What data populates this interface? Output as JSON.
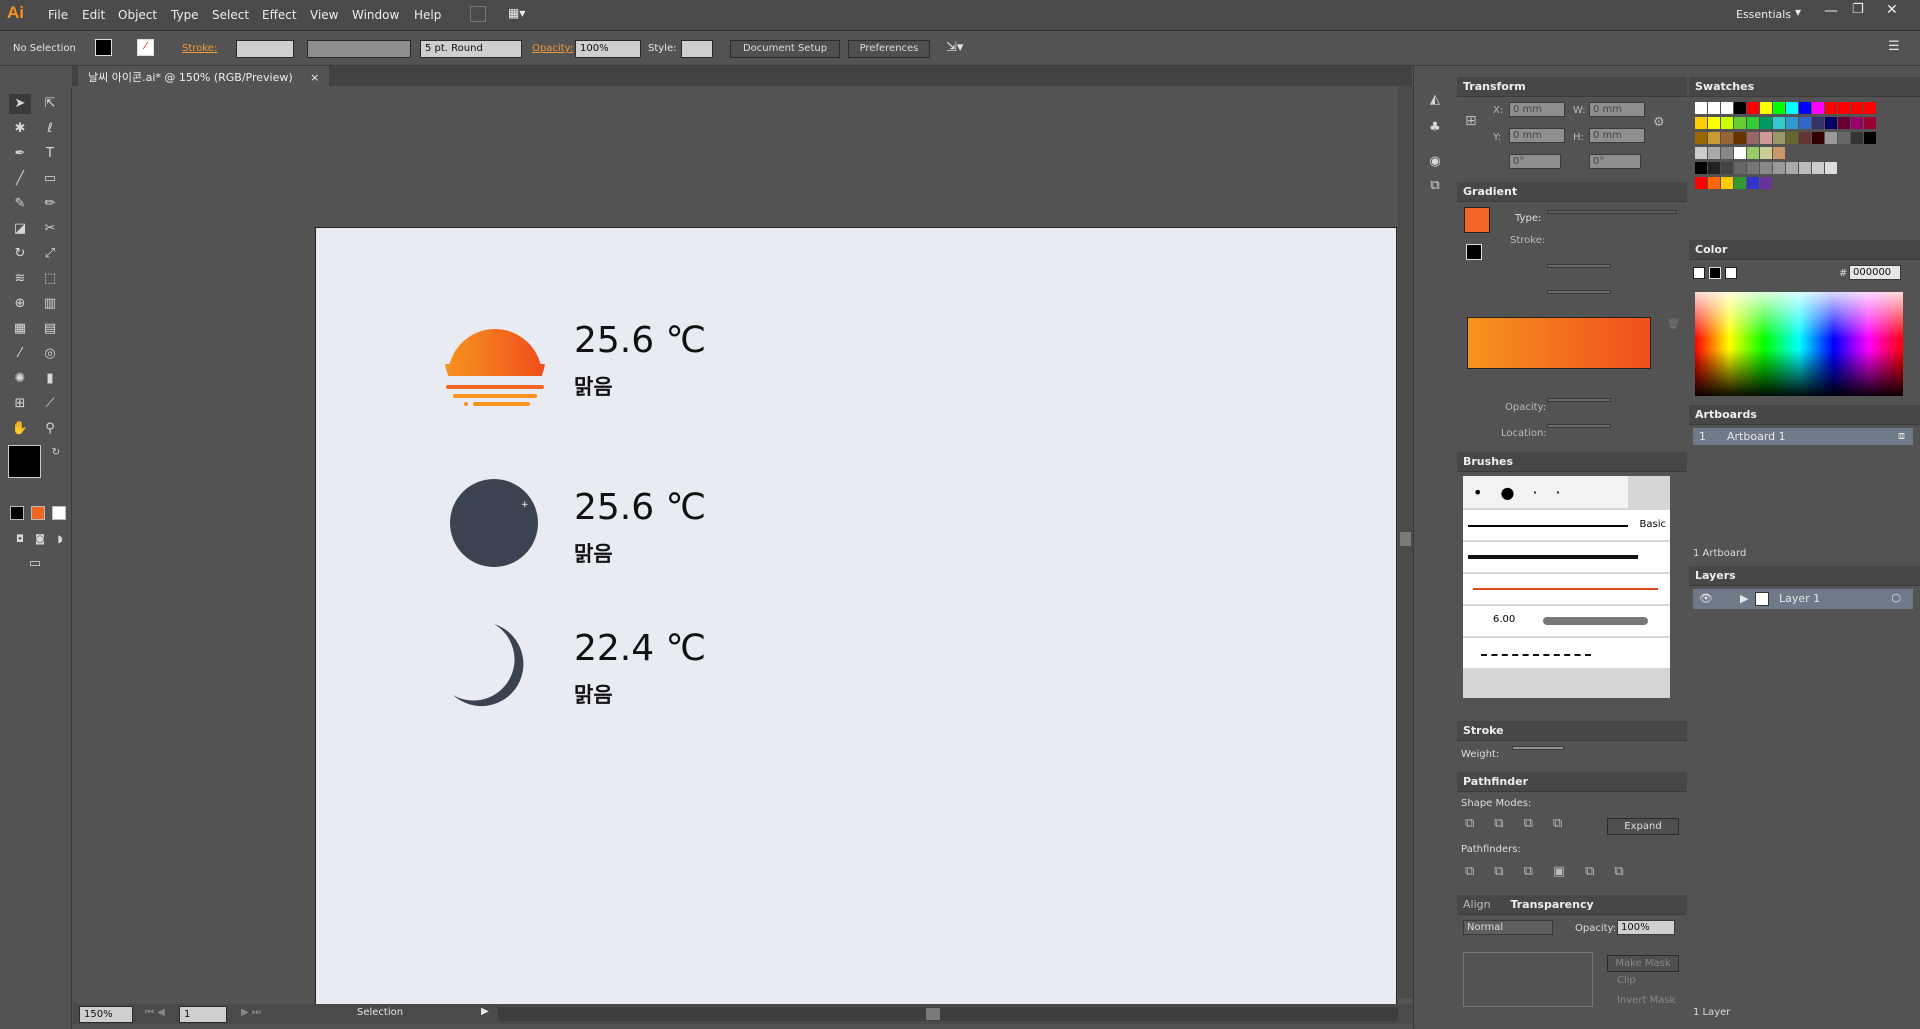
{
  "app": {
    "logo": "Ai",
    "workspace": "Essentials"
  },
  "menu": [
    "File",
    "Edit",
    "Object",
    "Type",
    "Select",
    "Effect",
    "View",
    "Window",
    "Help"
  ],
  "control": {
    "selection": "No Selection",
    "stroke_label": "Stroke:",
    "brush": "5 pt. Round",
    "opacity_label": "Opacity:",
    "opacity": "100%",
    "style_label": "Style:",
    "doc_setup": "Document Setup",
    "preferences": "Preferences"
  },
  "doc": {
    "tab": "날씨 아이콘.ai* @ 150% (RGB/Preview)",
    "close": "×"
  },
  "weather": [
    {
      "temp": "25.6 ℃",
      "cond": "맑음"
    },
    {
      "temp": "25.6 ℃",
      "cond": "맑음"
    },
    {
      "temp": "22.4 ℃",
      "cond": "맑음"
    }
  ],
  "status": {
    "zoom": "150%",
    "page": "1",
    "tool": "Selection"
  },
  "transform": {
    "title": "Transform",
    "x_label": "X:",
    "x": "0 mm",
    "w_label": "W:",
    "w": "0 mm",
    "y_label": "Y:",
    "y": "0 mm",
    "h_label": "H:",
    "h": "0 mm",
    "angle": "0°",
    "shear": "0°"
  },
  "gradient": {
    "title": "Gradient",
    "type_label": "Type:",
    "stroke_label": "Stroke:",
    "opacity_label": "Opacity:",
    "location_label": "Location:"
  },
  "brushes": {
    "title": "Brushes",
    "basic": "Basic",
    "size": "6.00"
  },
  "stroke": {
    "title": "Stroke",
    "weight_label": "Weight:"
  },
  "pathfinder": {
    "title": "Pathfinder",
    "shape_modes": "Shape Modes:",
    "expand": "Expand",
    "pathfinders": "Pathfinders:"
  },
  "transparency": {
    "align_tab": "Align",
    "title": "Transparency",
    "mode": "Normal",
    "opacity_label": "Opacity:",
    "opacity": "100%",
    "make_mask": "Make Mask",
    "clip": "Clip",
    "invert": "Invert Mask"
  },
  "swatches": {
    "title": "Swatches"
  },
  "color": {
    "title": "Color",
    "hash": "#",
    "hex": "000000"
  },
  "artboards": {
    "title": "Artboards",
    "num": "1",
    "name": "Artboard 1",
    "count": "1 Artboard"
  },
  "layers": {
    "title": "Layers",
    "name": "Layer 1",
    "count": "1 Layer"
  },
  "colors": {
    "accent": "#f7931e",
    "sun_start": "#f7931e",
    "sun_end": "#f26522",
    "moon": "#3b4250",
    "artboard": "#e8ecf2"
  }
}
